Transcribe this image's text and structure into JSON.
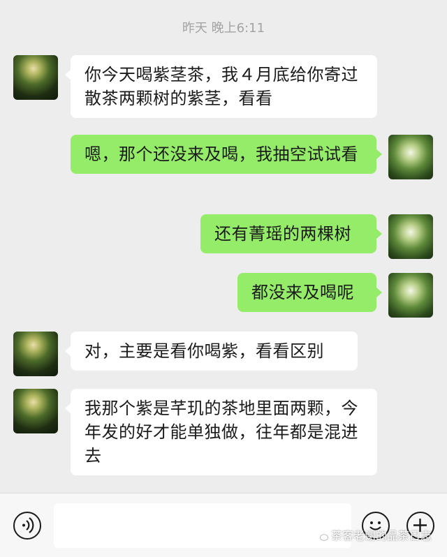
{
  "timestamp": "昨天 晚上6:11",
  "messages": [
    {
      "side": "in",
      "text": "你今天喝紫茎茶，我４月底给你寄过散茶两颗树的紫茎，看看",
      "avatar": "forest-avatar-icon"
    },
    {
      "side": "out",
      "text": "嗯，那个还没来及喝，我抽空试试看",
      "avatar": "tree-avatar-icon"
    },
    {
      "side": "out",
      "text": "还有菁瑶的两棵树",
      "avatar": "tree-avatar-icon"
    },
    {
      "side": "out",
      "text": "都没来及喝呢",
      "avatar": "tree-avatar-icon"
    },
    {
      "side": "in",
      "text": "对，主要是看你喝紫，看看区别",
      "avatar": "forest-avatar-icon"
    },
    {
      "side": "in",
      "text": "我那个紫是芊玑的茶地里面两颗，今年发的好才能单独做，往年都是混进去",
      "avatar": "forest-avatar-icon"
    }
  ],
  "input_bar": {
    "voice_icon": "voice-icon",
    "emoji_icon": "emoji-icon",
    "add_icon": "plus-icon",
    "value": ""
  },
  "watermark": "茶客老谢的品茶日志",
  "colors": {
    "background": "#ededed",
    "incoming_bubble": "#ffffff",
    "outgoing_bubble": "#95ec69",
    "timestamp": "#a3a3a3"
  }
}
